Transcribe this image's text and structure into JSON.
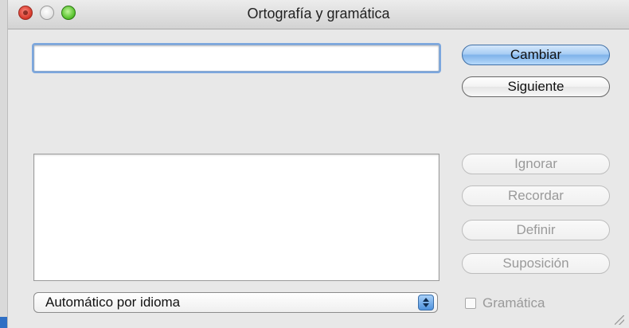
{
  "window": {
    "title": "Ortografía y gramática"
  },
  "word_field": {
    "value": ""
  },
  "buttons": {
    "change": "Cambiar",
    "next": "Siguiente",
    "ignore": "Ignorar",
    "remember": "Recordar",
    "define": "Definir",
    "guess": "Suposición"
  },
  "language_select": {
    "selected": "Automático por idioma"
  },
  "grammar_checkbox": {
    "label": "Gramática",
    "checked": false
  },
  "colors": {
    "primary_button": "#7fb3ea",
    "focus_ring": "#7ca7de",
    "close_button": "#d63a2c",
    "zoom_button": "#58c22e"
  }
}
